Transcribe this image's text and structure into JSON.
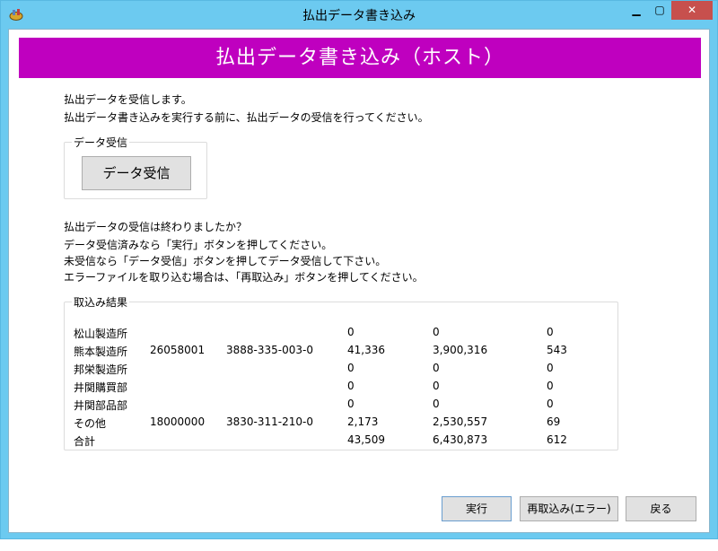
{
  "window": {
    "title": "払出データ書き込み"
  },
  "banner": {
    "title": "払出データ書き込み（ホスト）"
  },
  "intro": {
    "line1": "払出データを受信します。",
    "line2": "払出データ書き込みを実行する前に、払出データの受信を行ってください。"
  },
  "receive_group": {
    "title": "データ受信",
    "button_label": "データ受信"
  },
  "instructions": {
    "line1": "払出データの受信は終わりましたか？",
    "line2": "データ受信済みなら「実行」ボタンを押してください。",
    "line3": "未受信なら「データ受信」ボタンを押してデータ受信して下さい。",
    "line4": "エラーファイルを取り込む場合は、「再取込み」ボタンを押してください。"
  },
  "results": {
    "title": "取込み結果",
    "rows": [
      {
        "name": "松山製造所",
        "code": "",
        "account": "",
        "v1": "0",
        "v2": "0",
        "v3": "0"
      },
      {
        "name": "熊本製造所",
        "code": "26058001",
        "account": "3888-335-003-0",
        "v1": "41,336",
        "v2": "3,900,316",
        "v3": "543"
      },
      {
        "name": "邦栄製造所",
        "code": "",
        "account": "",
        "v1": "0",
        "v2": "0",
        "v3": "0"
      },
      {
        "name": "井関購買部",
        "code": "",
        "account": "",
        "v1": "0",
        "v2": "0",
        "v3": "0"
      },
      {
        "name": "井関部品部",
        "code": "",
        "account": "",
        "v1": "0",
        "v2": "0",
        "v3": "0"
      },
      {
        "name": "その他",
        "code": "18000000",
        "account": "3830-311-210-0",
        "v1": "2,173",
        "v2": "2,530,557",
        "v3": "69"
      },
      {
        "name": "合計",
        "code": "",
        "account": "",
        "v1": "43,509",
        "v2": "6,430,873",
        "v3": "612"
      }
    ]
  },
  "buttons": {
    "execute": "実行",
    "reimport": "再取込み(エラー)",
    "back": "戻る"
  },
  "colors": {
    "banner": "#bf00bf",
    "titlebar": "#6ccaf0",
    "close": "#c7504d"
  },
  "icons": {
    "app": "app-icon",
    "minimize": "minimize-icon",
    "maximize": "maximize-icon",
    "close": "close-icon"
  }
}
